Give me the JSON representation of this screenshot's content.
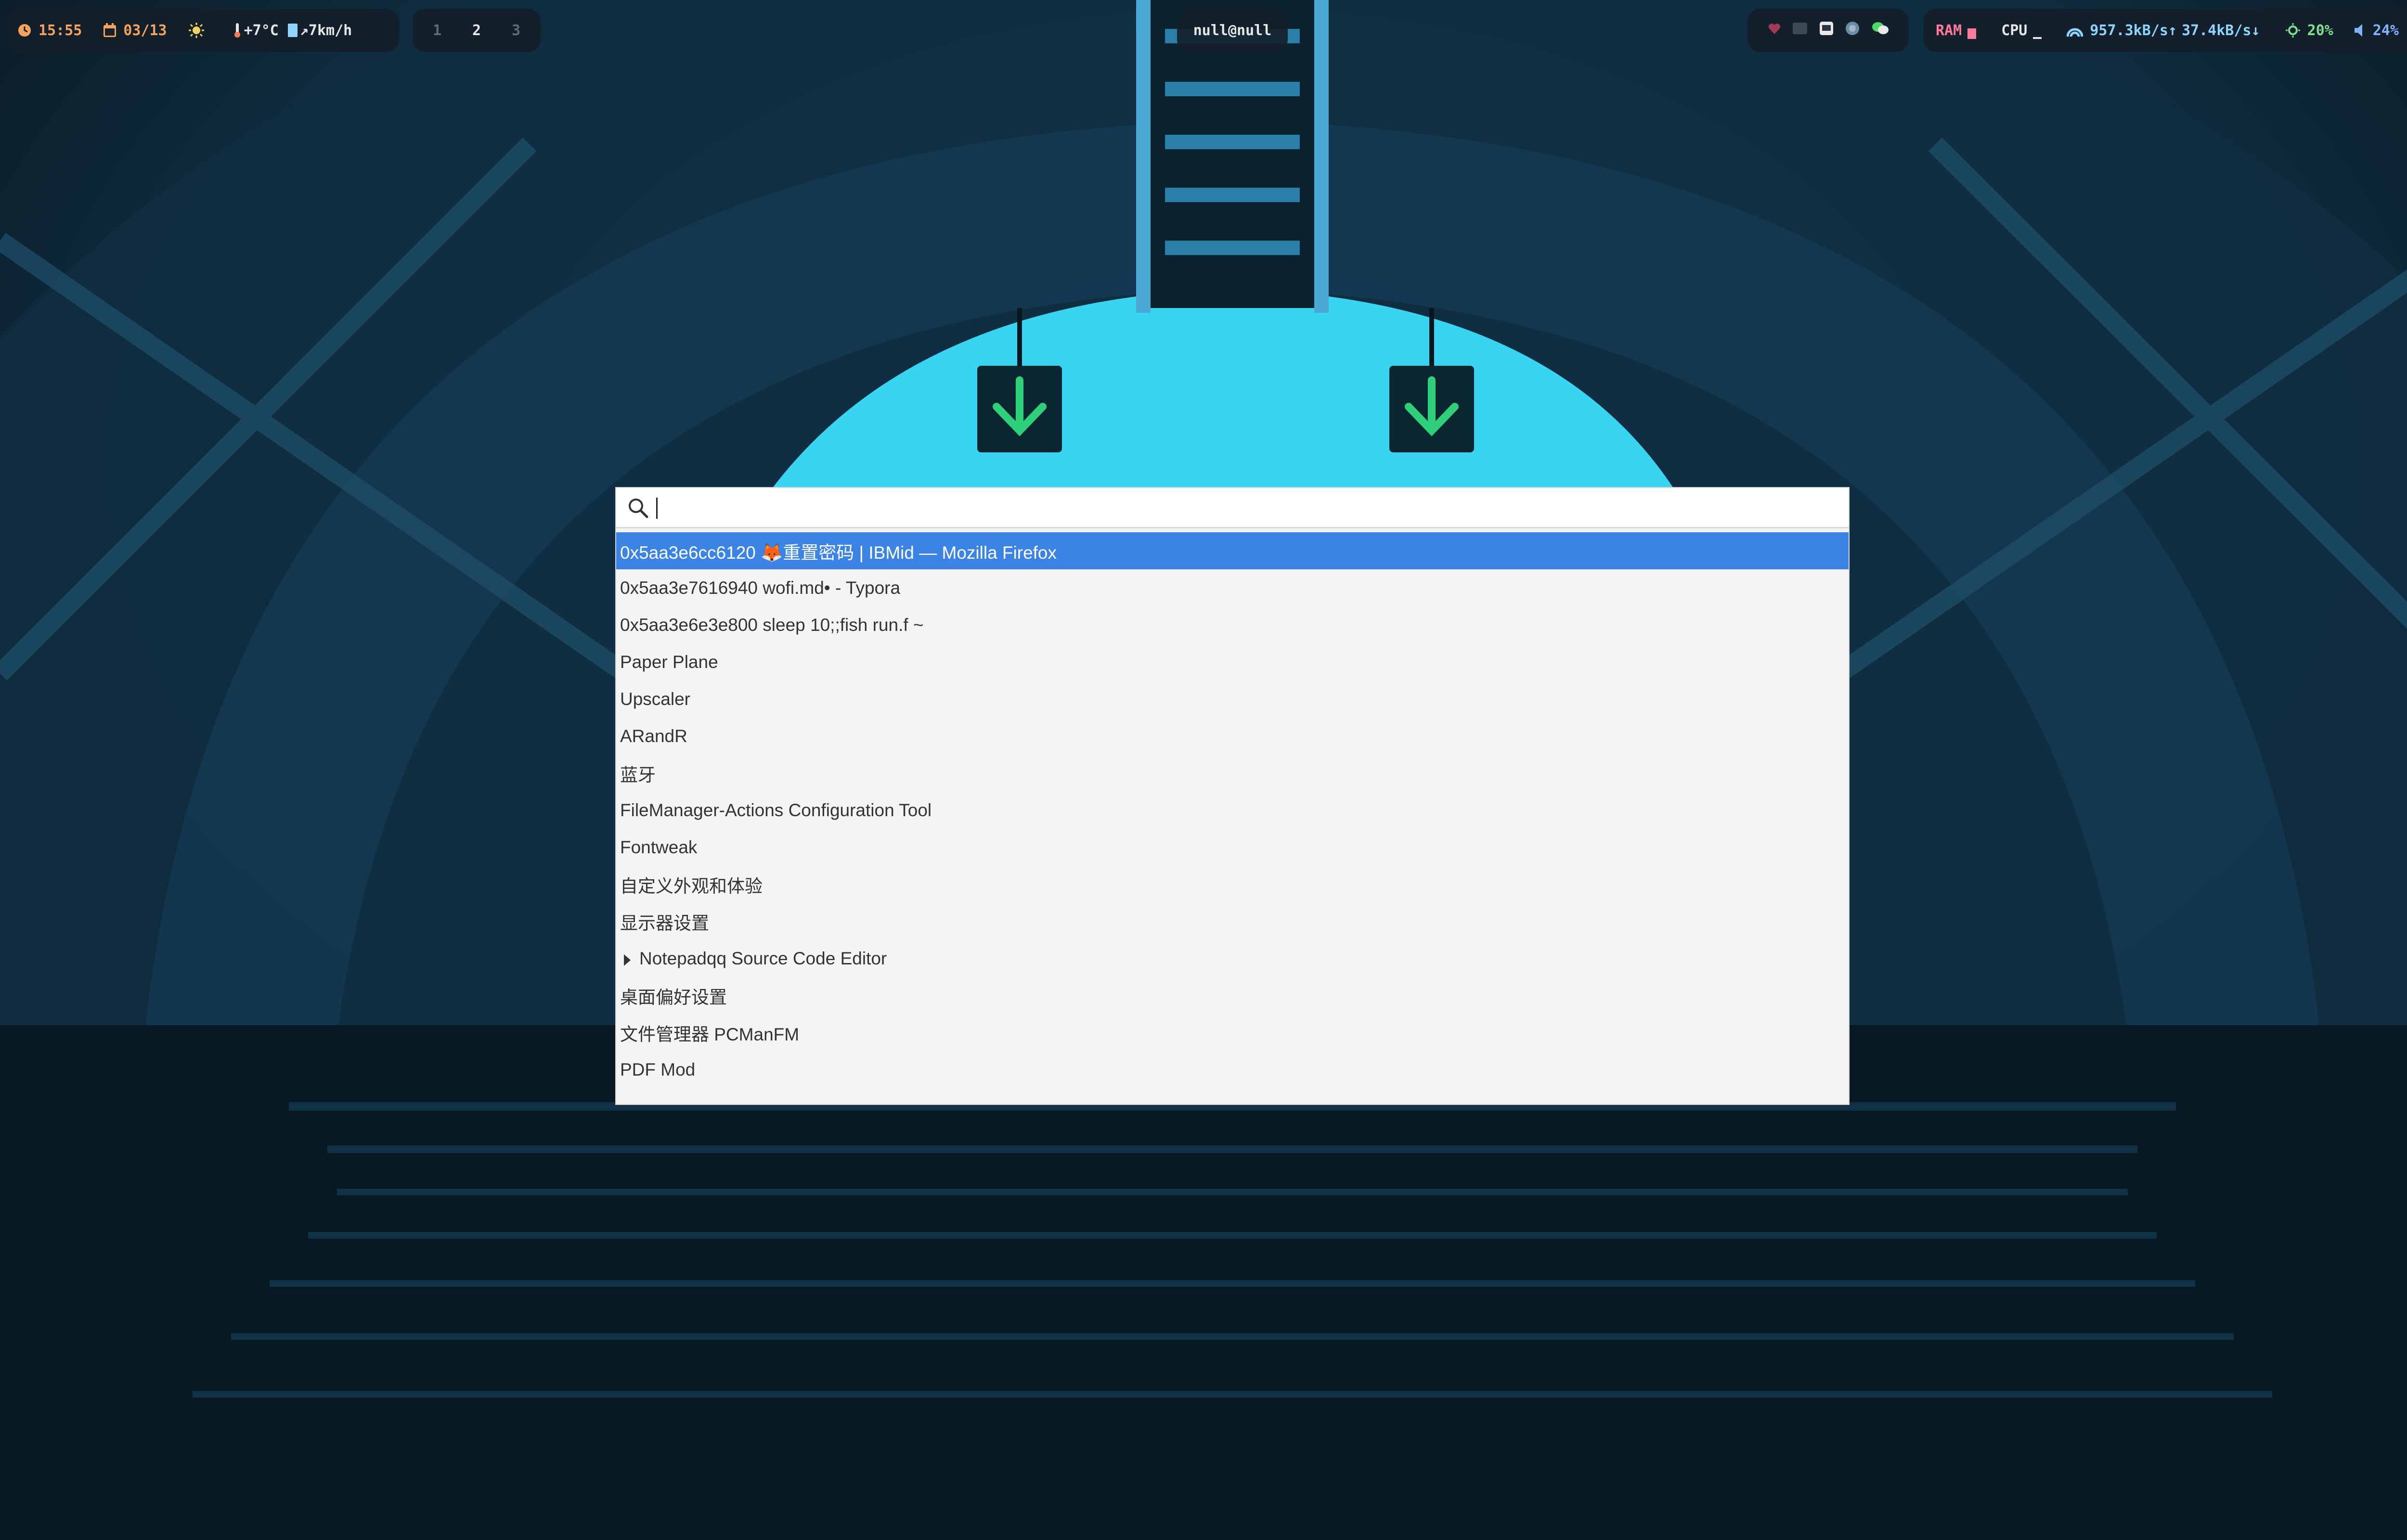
{
  "topbar": {
    "clock": {
      "icon": "clock-icon",
      "time": "15:55"
    },
    "date": {
      "icon": "calendar-icon",
      "value": "03/13"
    },
    "weather": {
      "icon": "sun-icon",
      "temperature": "+7°C",
      "wind": "↗7km/h"
    },
    "workspaces": [
      "1",
      "2",
      "3"
    ],
    "active_workspace": "2",
    "title": "null@null",
    "tray_icons": [
      "heart-icon",
      "window-icon",
      "screenshot-icon",
      "globe-icon",
      "wechat-icon"
    ],
    "ram": {
      "label": "RAM",
      "usage": 0.6
    },
    "cpu": {
      "label": "CPU",
      "usage": 0.1
    },
    "network": {
      "icon": "network-icon",
      "up": "957.3kB/s↑",
      "down": "37.4kB/s↓"
    },
    "brightness": {
      "icon": "brightness-icon",
      "value": "20%"
    },
    "volume": {
      "icon": "speaker-icon",
      "value": "24%"
    },
    "colors": {
      "clock": "#f5a25d",
      "weather": "#f4d35e",
      "ram": "#ff7a9a",
      "network": "#8fd3ff",
      "brightness": "#7ee08e",
      "volume": "#7fb2ff"
    }
  },
  "launcher": {
    "query": "",
    "items": [
      {
        "label": "0x5aa3e6cc6120 🦊重置密码 | IBMid — Mozilla Firefox",
        "selected": true
      },
      {
        "label": "0x5aa3e7616940 wofi.md• - Typora"
      },
      {
        "label": "0x5aa3e6e3e800 sleep 10;;fish run.f ~"
      },
      {
        "label": "Paper Plane"
      },
      {
        "label": "Upscaler"
      },
      {
        "label": "ARandR"
      },
      {
        "label": "蓝牙"
      },
      {
        "label": "FileManager-Actions Configuration Tool"
      },
      {
        "label": "Fontweak"
      },
      {
        "label": "自定义外观和体验"
      },
      {
        "label": "显示器设置"
      },
      {
        "label": "Notepadqq Source Code Editor",
        "expandable": true
      },
      {
        "label": "桌面偏好设置"
      },
      {
        "label": "文件管理器 PCManFM"
      },
      {
        "label": "PDF Mod"
      }
    ],
    "colors": {
      "selected_bg": "#3b84e6",
      "panel_bg": "#f5f4f2"
    }
  }
}
